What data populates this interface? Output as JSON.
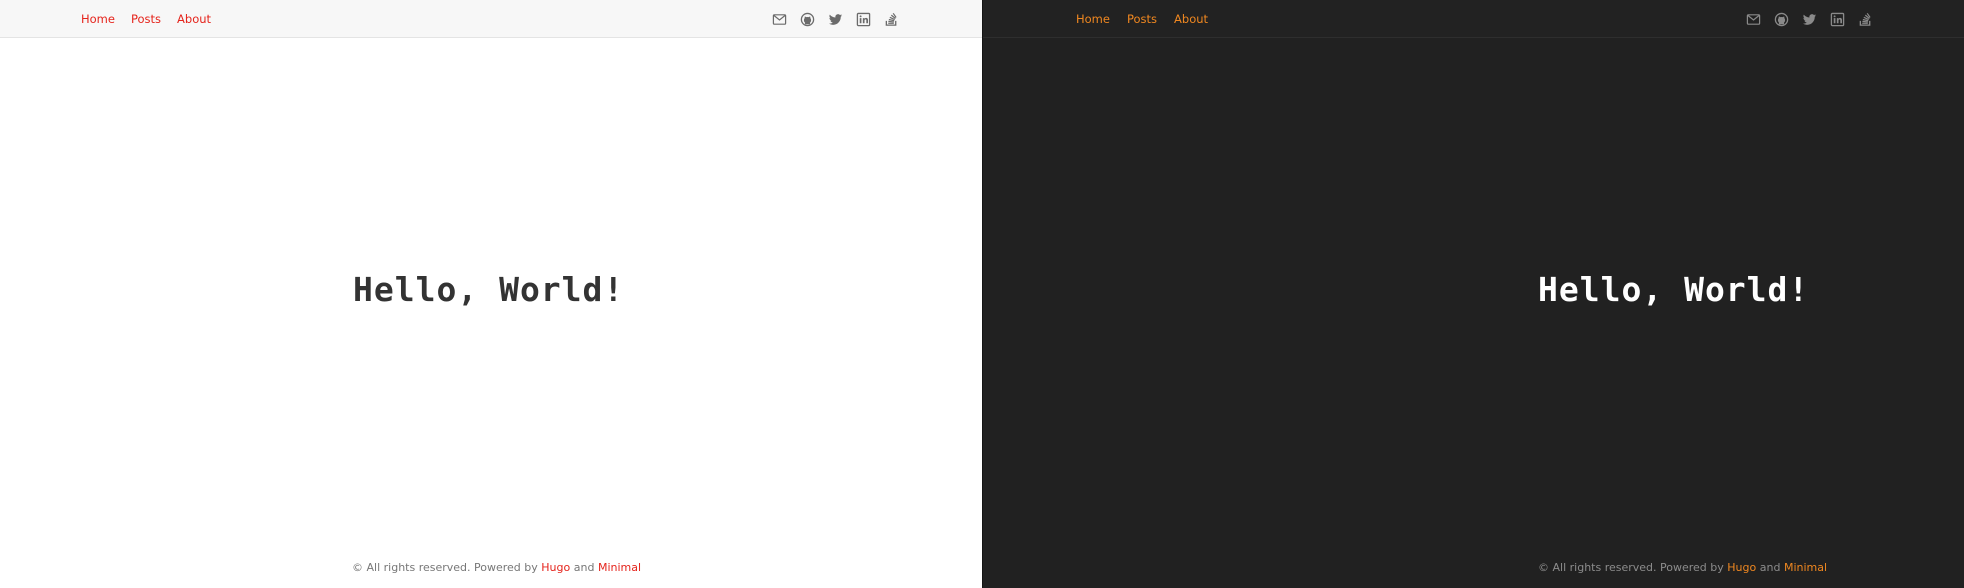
{
  "nav": {
    "home": "Home",
    "posts": "Posts",
    "about": "About"
  },
  "socials": [
    "mail-icon",
    "github-icon",
    "twitter-icon",
    "linkedin-icon",
    "stackoverflow-icon"
  ],
  "main": {
    "heading": "Hello, World!"
  },
  "footer": {
    "prefix": "© All rights reserved. Powered by",
    "hugo": "Hugo",
    "and": "and",
    "minimal": "Minimal"
  },
  "colors": {
    "light_accent": "#e5241c",
    "dark_accent": "#ef8720",
    "light_bg": "#ffffff",
    "dark_bg": "#212121"
  }
}
